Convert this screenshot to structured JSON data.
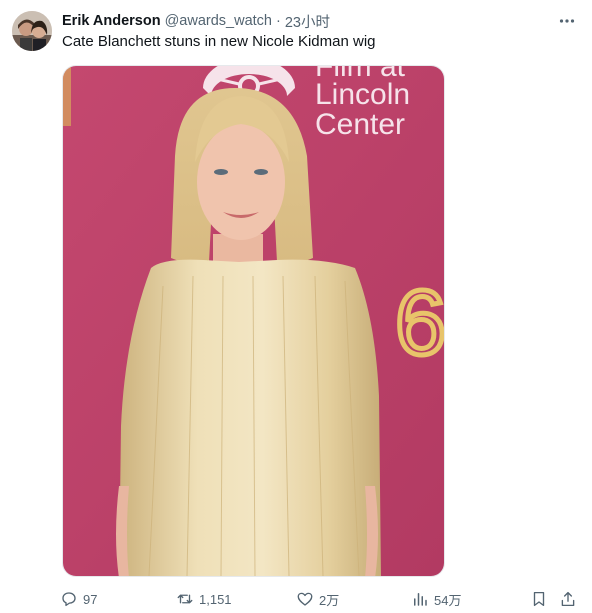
{
  "tweet": {
    "author": {
      "display_name": "Erik Anderson",
      "handle": "@awards_watch",
      "separator": "·",
      "time": "23小时"
    },
    "text": "Cate Blanchett stuns in new Nicole Kidman wig",
    "media": {
      "backdrop_lines": [
        "Film at",
        "Lincoln",
        "Center"
      ],
      "backdrop_digit": "6",
      "colors": {
        "backdrop": "#c0446c",
        "logo_text": "#f6e3ea",
        "digit": "#e8c46a",
        "hair": "#e7d3a6"
      }
    },
    "stats": {
      "replies": "97",
      "reposts": "1,151",
      "likes": "2万",
      "views": "54万"
    },
    "icons": {
      "more": "more-horizontal-icon",
      "reply": "reply-icon",
      "repost": "repost-icon",
      "like": "heart-icon",
      "views": "bar-chart-icon",
      "bookmark": "bookmark-icon",
      "share": "share-icon"
    }
  }
}
